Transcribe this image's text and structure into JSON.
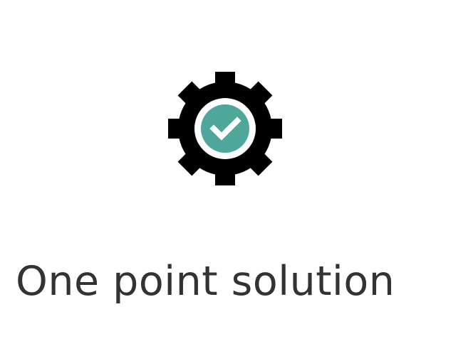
{
  "feature": {
    "icon": "gear-check-icon",
    "title": "One point solution"
  },
  "colors": {
    "gear": "#000000",
    "badge": "#4fa69a",
    "check": "#ffffff",
    "title": "#333333"
  }
}
